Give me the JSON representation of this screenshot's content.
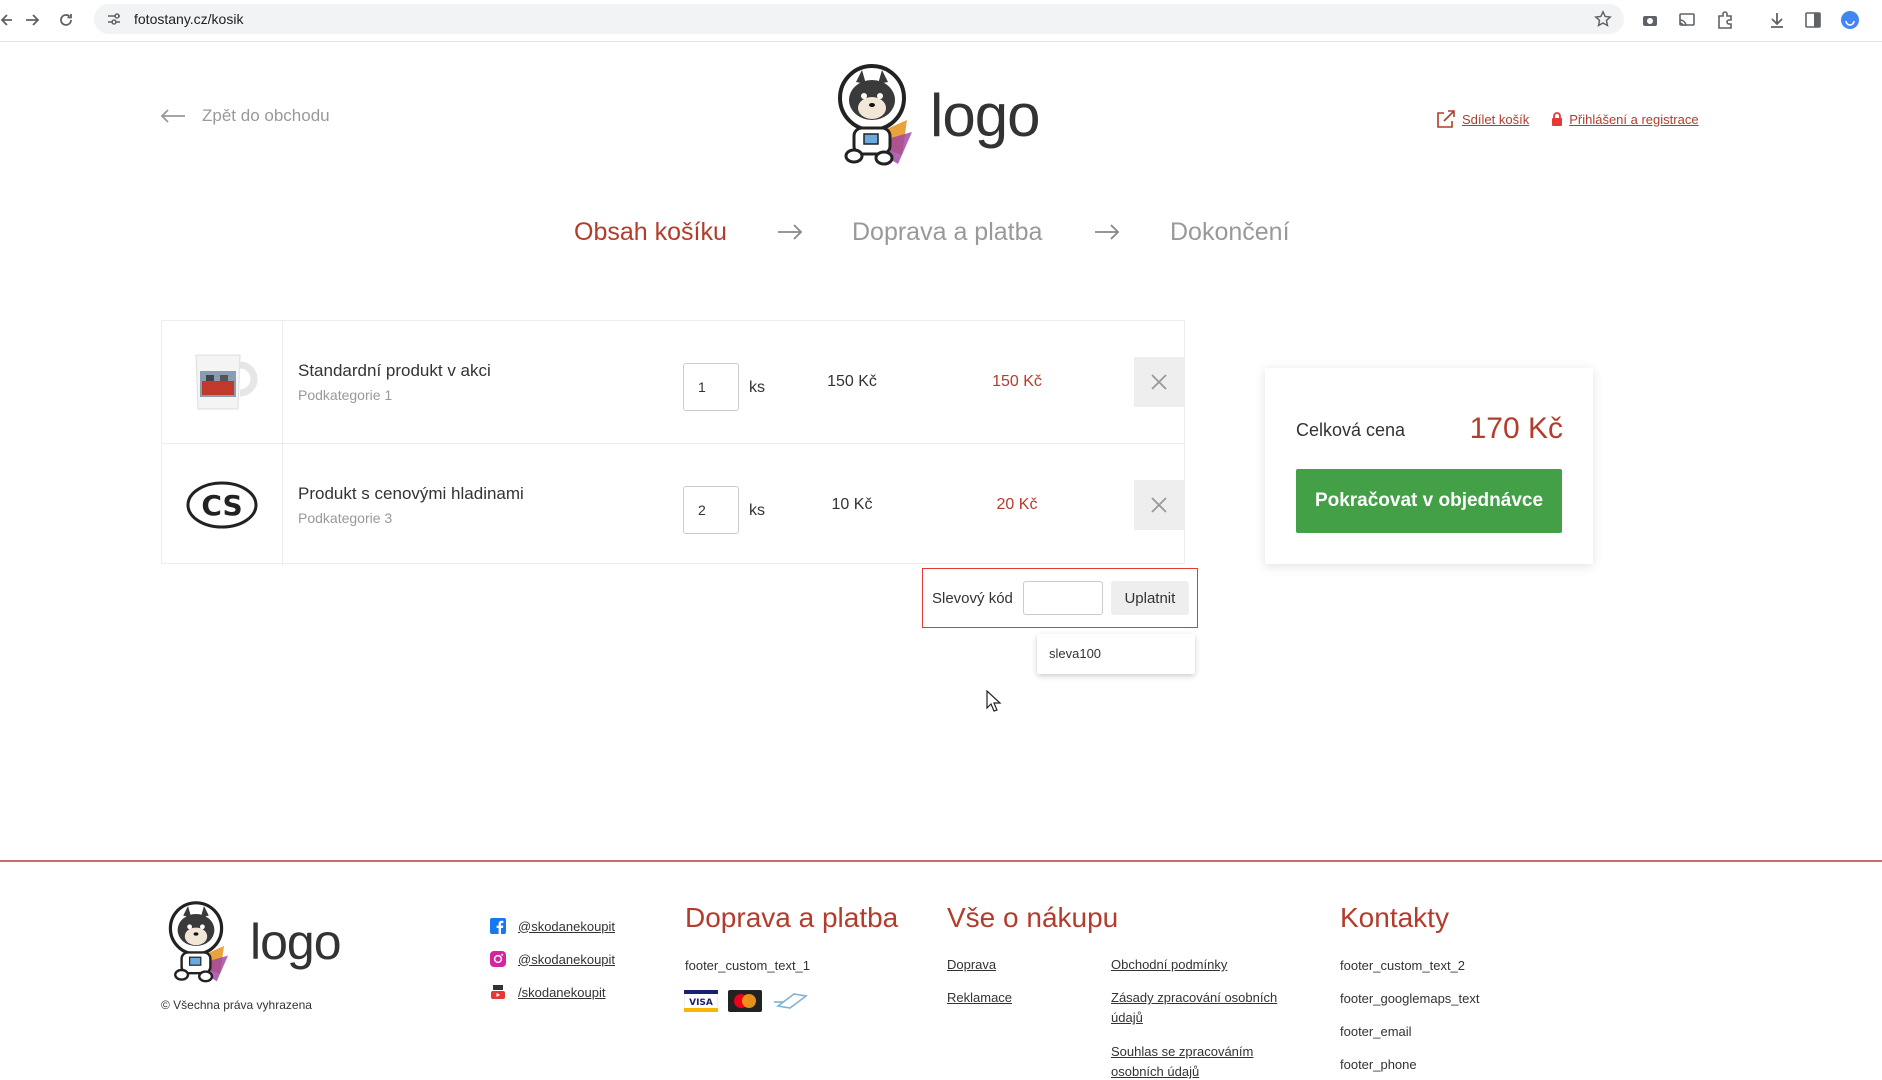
{
  "browser": {
    "url": "fotostany.cz/kosik"
  },
  "header": {
    "back_label": "Zpět do obchodu",
    "logo_text": "logo",
    "share_label": "Sdílet košík",
    "login_label": "Přihlášení a registrace"
  },
  "steps": [
    {
      "label": "Obsah košíku",
      "active": true
    },
    {
      "label": "Doprava a platba",
      "active": false
    },
    {
      "label": "Dokončení",
      "active": false
    }
  ],
  "cart": {
    "items": [
      {
        "name": "Standardní produkt v akci",
        "category": "Podkategorie 1",
        "quantity": "1",
        "unit": "ks",
        "price": "150 Kč",
        "total": "150 Kč",
        "image": "mug-image"
      },
      {
        "name": "Produkt s cenovými hladinami",
        "category": "Podkategorie 3",
        "quantity": "2",
        "unit": "ks",
        "price": "10 Kč",
        "total": "20 Kč",
        "image": "cs-sticker-image"
      }
    ],
    "discount_label": "Slevový kód",
    "discount_value": "",
    "apply_label": "Uplatnit",
    "autocomplete_suggestion": "sleva100"
  },
  "summary": {
    "total_label": "Celková cena",
    "total_value": "170 Kč",
    "continue_label": "Pokračovat v objednávce"
  },
  "footer": {
    "logo_text": "logo",
    "copyright": "© Všechna práva vyhrazena",
    "social": [
      {
        "network": "facebook-icon",
        "label": "@skodanekoupit"
      },
      {
        "network": "instagram-icon",
        "label": "@skodanekoupit"
      },
      {
        "network": "youtube-icon",
        "label": "/skodanekoupit"
      }
    ],
    "shipping": {
      "title": "Doprava a platba",
      "text": "footer_custom_text_1",
      "payment_icons": [
        "visa-icon",
        "mastercard-icon",
        "wallet-icon"
      ]
    },
    "about": {
      "title": "Vše o nákupu",
      "links": [
        "Doprava",
        "Reklamace",
        "Obchodní podmínky",
        "Zásady zpracování osobních údajů",
        "Souhlas se zpracováním osobních údajů"
      ]
    },
    "contacts": {
      "title": "Kontakty",
      "lines": [
        "footer_custom_text_2",
        "footer_googlemaps_text",
        "footer_email",
        "footer_phone"
      ]
    }
  },
  "colors": {
    "accent": "#b33c2c",
    "cta": "#43a047",
    "discount_border": "#e53935"
  }
}
